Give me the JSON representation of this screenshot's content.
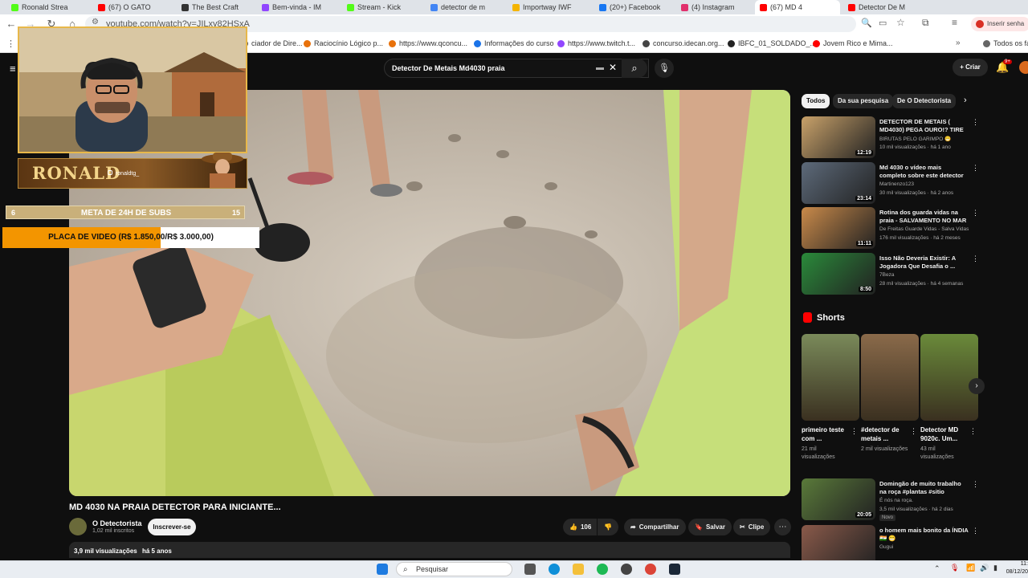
{
  "browser": {
    "tabs": [
      {
        "label": "Roonald Strea",
        "color": "#53fc18"
      },
      {
        "label": "(67) O GATO",
        "color": "#ff0000"
      },
      {
        "label": "The Best Craft",
        "color": "#333333"
      },
      {
        "label": "Bem-vinda - IM",
        "color": "#9146ff"
      },
      {
        "label": "Stream - Kick",
        "color": "#53fc18"
      },
      {
        "label": "detector de m",
        "color": "#4285f4"
      },
      {
        "label": "Importway IWF",
        "color": "#f4b400"
      },
      {
        "label": "(20+) Facebook",
        "color": "#1877f2"
      },
      {
        "label": "(4) Instagram",
        "color": "#e1306c"
      },
      {
        "label": "(67) MD 4",
        "color": "#ff0000"
      },
      {
        "label": "Detector De M",
        "color": "#ff0000"
      }
    ],
    "url": "youtube.com/watch?v=JILxy82HSxA",
    "profile_button": "Inserir senha",
    "bookmarks": [
      {
        "label": "ciador de Dire...",
        "color": "#555555"
      },
      {
        "label": "Raciocínio Lógico p...",
        "color": "#e8710a"
      },
      {
        "label": "https://www.qconcu...",
        "color": "#e8710a"
      },
      {
        "label": "Informações do curso",
        "color": "#1a73e8"
      },
      {
        "label": "https://www.twitch.t...",
        "color": "#9146ff"
      },
      {
        "label": "concurso.idecan.org...",
        "color": "#444444"
      },
      {
        "label": "IBFC_01_SOLDADO_...",
        "color": "#222222"
      },
      {
        "label": "Jovem Rico e Mima...",
        "color": "#ff0000"
      },
      {
        "label": "Todos os fa",
        "color": "#666666"
      }
    ]
  },
  "youtube": {
    "search_query": "Detector De Metais Md4030 praia",
    "create_label": "Criar",
    "notification_badge": "9+",
    "video": {
      "title": "MD 4030 NA PRAIA DETECTOR PARA INICIANTE...",
      "channel": "O Detectorista",
      "subscribers": "1,02 mil inscritos",
      "subscribe_label": "Inscrever-se",
      "likes": "106",
      "share_label": "Compartilhar",
      "save_label": "Salvar",
      "clip_label": "Clipe",
      "views": "3,9 mil visualizações",
      "age": "há 5 anos"
    },
    "filter_chips": [
      "Todos",
      "Da sua pesquisa",
      "De O Detectorista"
    ],
    "recommendations": [
      {
        "title": "DETECTOR DE METAIS ( MD4030) PEGA OURO!? TIRE ...",
        "channel": "BIRUTAS PELO GARIMPO 😁",
        "meta": "10 mil visualizações · há 1 ano",
        "duration": "12:19",
        "color": "#c9a26a"
      },
      {
        "title": "Md 4030 o vídeo mais completo sobre este detector de metais.",
        "channel": "Martinenzo123",
        "meta": "30 mil visualizações · há 2 anos",
        "duration": "23:14",
        "color": "#5d6a7a"
      },
      {
        "title": "Rotina dos guarda vidas na praia - SALVAMENTO NO MAR",
        "channel": "De Freitas Guarde Vidas - Salva Vidas",
        "meta": "176 mil visualizações · há 2 meses",
        "duration": "11:11",
        "color": "#c98a4a"
      },
      {
        "title": "Isso Não Deveria Existir: A Jogadora Que Desafia o ...",
        "channel": "7Beza",
        "meta": "28 mil visualizações · há 4 semanas",
        "duration": "8:50",
        "color": "#2a8a3a"
      }
    ],
    "shorts_heading": "Shorts",
    "shorts": [
      {
        "title": "primeiro teste com ...",
        "views": "21 mil visualizações",
        "color": "#7a8a5a"
      },
      {
        "title": "#detector de metais ...",
        "views": "2 mil visualizações",
        "color": "#8a6a4a"
      },
      {
        "title": "Detector MD 9020c. Um...",
        "views": "43 mil visualizações",
        "color": "#6a8a3a"
      }
    ],
    "recommendations_bottom": [
      {
        "title": "Domingão de muito trabalho na roça #plantas #sitio #fazenda ...",
        "channel": "É nós na roça.",
        "meta": "3,5 mil visualizações · há 2 dias",
        "badge": "Novo",
        "duration": "20:05",
        "color": "#5a7a3a"
      },
      {
        "title": "o homem mais bonito da ÍNDIA 🇮🇳 😁",
        "channel": "Gugui",
        "meta": "",
        "duration": "",
        "color": "#8a5a4a"
      }
    ]
  },
  "overlay": {
    "streamer_name": "RONALD",
    "streamer_handle": "ronaldtg_",
    "goal": {
      "min": "6",
      "label": "META DE 24H DE SUBS",
      "max": "15"
    },
    "gpu_goal": {
      "label": "PLACA DE VIDEO (R$ 1.850,00/R$ 3.000,00)",
      "progress": 0.6167
    }
  },
  "taskbar": {
    "search_placeholder": "Pesquisar",
    "time": "11:",
    "date": "08/12/20"
  }
}
